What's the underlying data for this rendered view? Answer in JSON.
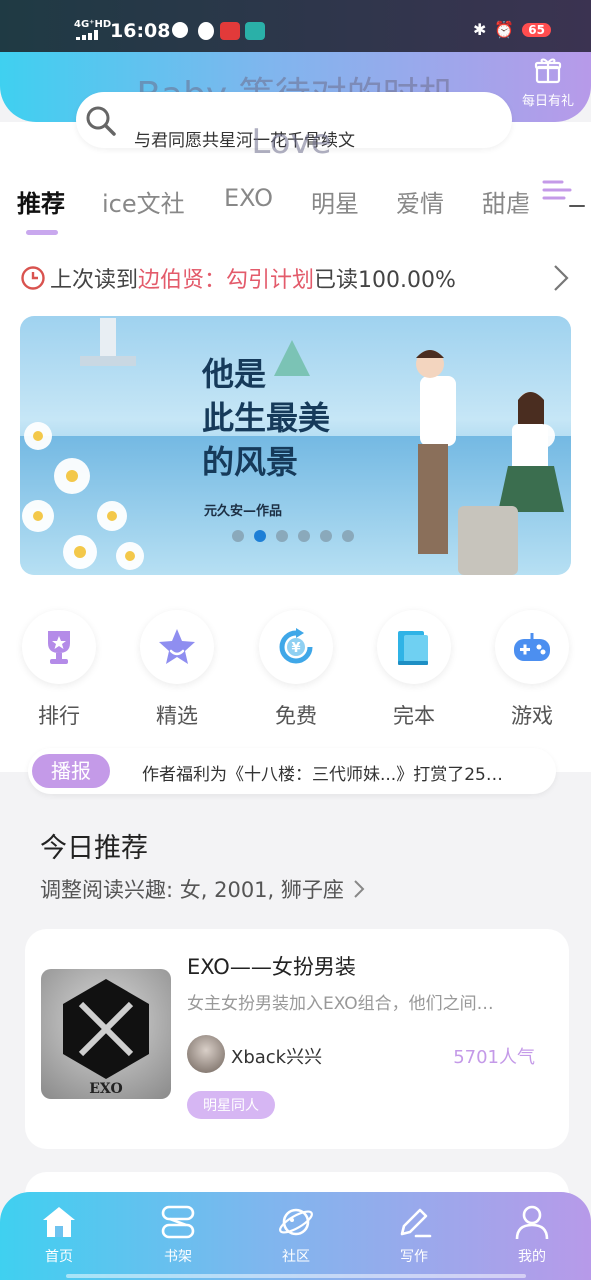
{
  "status_bar": {
    "network": "4G⁺HD",
    "time": "16:08",
    "battery": "65"
  },
  "watermark": {
    "line1": "Baby 等待对的时机",
    "line2": "Love"
  },
  "gift": {
    "label": "每日有礼",
    "icon": "gift-icon"
  },
  "search": {
    "placeholder": "与君同愿共星河一花千骨续文",
    "icon": "search-icon"
  },
  "tabs": [
    {
      "label": "推荐",
      "active": true
    },
    {
      "label": "ice文社"
    },
    {
      "label": "EXO"
    },
    {
      "label": "明星"
    },
    {
      "label": "爱情"
    },
    {
      "label": "甜虐"
    }
  ],
  "last_read": {
    "prefix": "上次读到",
    "book": "边伯贤：勾引计划",
    "suffix": "已读100.00%"
  },
  "banner": {
    "title_lines": [
      "他是",
      "此生最美",
      "的风景"
    ],
    "author": "元久安—作品",
    "active_dot": 1,
    "dot_count": 6
  },
  "categories": [
    {
      "label": "排行",
      "icon": "trophy-icon",
      "color": "#b48be8"
    },
    {
      "label": "精选",
      "icon": "star-icon",
      "color": "#8f8ef0"
    },
    {
      "label": "免费",
      "icon": "yuan-coin-icon",
      "color": "#3fa7e8"
    },
    {
      "label": "完本",
      "icon": "book-icon",
      "color": "#2fb3e6"
    },
    {
      "label": "游戏",
      "icon": "gamepad-icon",
      "color": "#4c8ff0"
    }
  ],
  "news": {
    "tag": "播报",
    "text": "作者福利为《十八楼：三代师妹...》打赏了25…"
  },
  "today": {
    "title": "今日推荐",
    "subtitle": "调整阅读兴趣: 女, 2001, 狮子座"
  },
  "book_card": {
    "title": "EXO——女扮男装",
    "desc": "女主女扮男装加入EXO组合，他们之间…",
    "author": "Xback兴兴",
    "popularity": "5701人气",
    "tag": "明星同人"
  },
  "bottom_nav": [
    {
      "label": "首页",
      "icon": "home-icon",
      "active": true
    },
    {
      "label": "书架",
      "icon": "bookshelf-icon"
    },
    {
      "label": "社区",
      "icon": "planet-icon"
    },
    {
      "label": "写作",
      "icon": "pen-icon"
    },
    {
      "label": "我的",
      "icon": "user-icon"
    }
  ],
  "colors": {
    "accent": "#c49ae8",
    "highlight": "#e35b6b",
    "gradient_start": "#3fd0f0",
    "gradient_end": "#b79ae9"
  }
}
